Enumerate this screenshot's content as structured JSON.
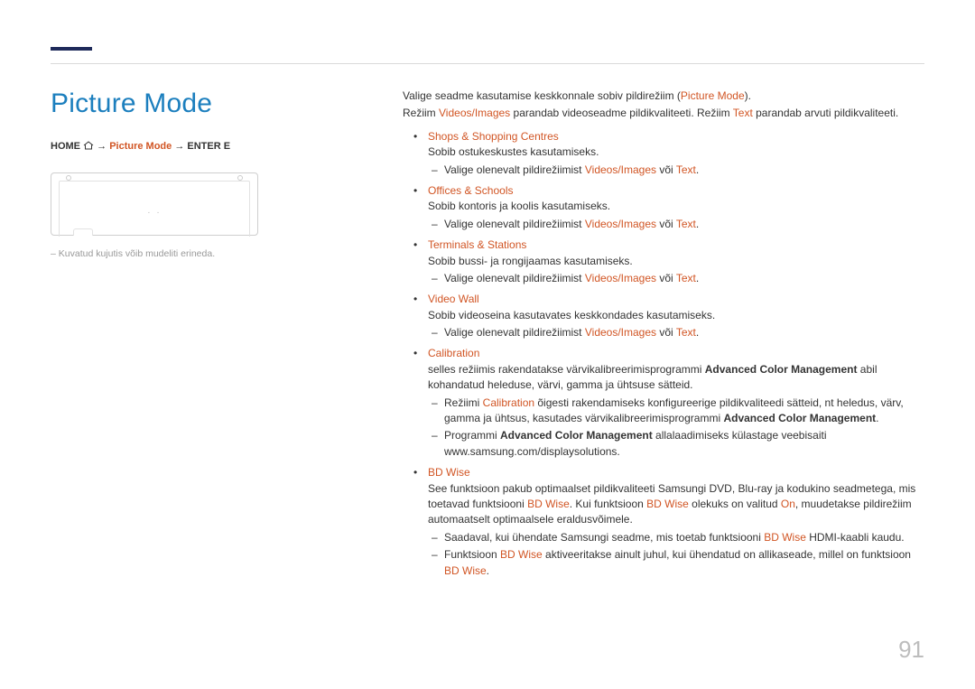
{
  "page": {
    "title": "Picture Mode",
    "page_number": "91"
  },
  "breadcrumb": {
    "home": "HOME",
    "arrow": "→",
    "mid": "Picture Mode",
    "tail": "ENTER E"
  },
  "left": {
    "footnote": "Kuvatud kujutis võib mudeliti erineda."
  },
  "right": {
    "intro1_a": "Valige seadme kasutamise keskkonnale sobiv pildirežiim (",
    "intro1_b": "Picture Mode",
    "intro1_c": ").",
    "intro2_a": "Režiim ",
    "intro2_b": "Videos/Images",
    "intro2_c": " parandab videoseadme pildikvaliteeti. Režiim ",
    "intro2_d": "Text",
    "intro2_e": " parandab arvuti pildikvaliteeti.",
    "items": [
      {
        "title": "Shops & Shopping Centres",
        "body": "Sobib ostukeskustes kasutamiseks.",
        "sub": [
          {
            "a": "Valige olenevalt pildirežiimist ",
            "b": "Videos/Images",
            "c": " või ",
            "d": "Text",
            "e": "."
          }
        ]
      },
      {
        "title": "Offices & Schools",
        "body": "Sobib kontoris ja koolis kasutamiseks.",
        "sub": [
          {
            "a": "Valige olenevalt pildirežiimist ",
            "b": "Videos/Images",
            "c": " või ",
            "d": "Text",
            "e": "."
          }
        ]
      },
      {
        "title": "Terminals & Stations",
        "body": "Sobib bussi- ja rongijaamas kasutamiseks.",
        "sub": [
          {
            "a": "Valige olenevalt pildirežiimist ",
            "b": "Videos/Images",
            "c": " või ",
            "d": "Text",
            "e": "."
          }
        ]
      },
      {
        "title": "Video Wall",
        "body": "Sobib videoseina kasutavates keskkondades kasutamiseks.",
        "sub": [
          {
            "a": "Valige olenevalt pildirežiimist ",
            "b": "Videos/Images",
            "c": " või ",
            "d": "Text",
            "e": "."
          }
        ]
      }
    ],
    "calibration": {
      "title": "Calibration",
      "body_a": "selles režiimis rakendatakse värvikalibreerimisprogrammi ",
      "body_b": "Advanced Color Management",
      "body_c": " abil kohandatud heleduse, värvi, gamma ja ühtsuse sätteid.",
      "sub1_a": "Režiimi ",
      "sub1_b": "Calibration",
      "sub1_c": " õigesti rakendamiseks konfigureerige pildikvaliteedi sätteid, nt heledus, värv, gamma ja ühtsus, kasutades värvikalibreerimisprogrammi ",
      "sub1_d": "Advanced Color Management",
      "sub1_e": ".",
      "sub2_a": "Programmi ",
      "sub2_b": "Advanced Color Management",
      "sub2_c": " allalaadimiseks külastage veebisaiti www.samsung.com/displaysolutions."
    },
    "bdwise": {
      "title": "BD Wise",
      "body_a": "See funktsioon pakub optimaalset pildikvaliteeti Samsungi DVD, Blu-ray ja kodukino seadmetega, mis toetavad funktsiooni ",
      "body_b": "BD Wise",
      "body_c": ". Kui funktsioon ",
      "body_d": "BD Wise",
      "body_e": " olekuks on valitud ",
      "body_f": "On",
      "body_g": ", muudetakse pildirežiim automaatselt optimaalsele eraldusvõimele.",
      "sub1_a": "Saadaval, kui ühendate Samsungi seadme, mis toetab funktsiooni ",
      "sub1_b": "BD Wise",
      "sub1_c": " HDMI-kaabli kaudu.",
      "sub2_a": "Funktsioon ",
      "sub2_b": "BD Wise",
      "sub2_c": " aktiveeritakse ainult juhul, kui ühendatud on allikaseade, millel on funktsioon ",
      "sub2_d": "BD Wise",
      "sub2_e": "."
    }
  }
}
